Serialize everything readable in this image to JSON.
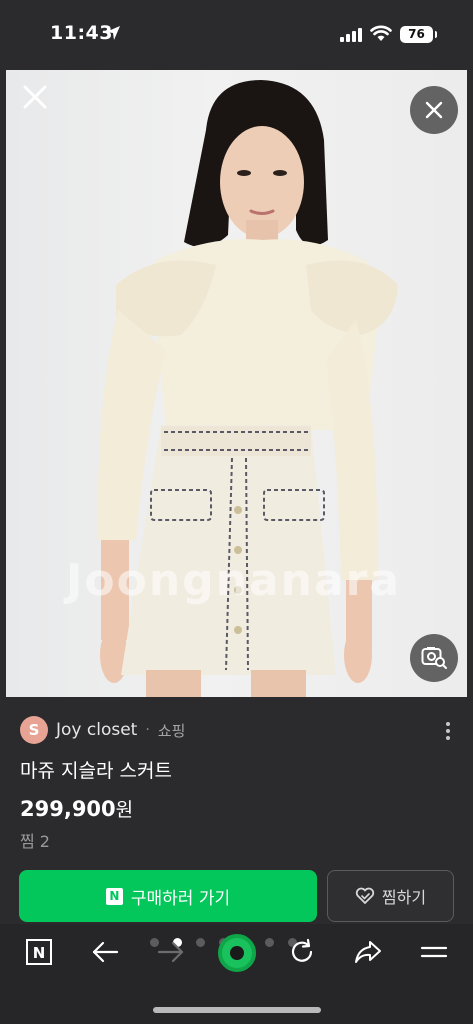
{
  "status_bar": {
    "time": "11:43",
    "battery": "76"
  },
  "photo": {
    "watermark": "Joongnanara"
  },
  "seller": {
    "avatar_letter": "S",
    "name": "Joy closet",
    "separator": "·",
    "type": "쇼핑"
  },
  "product": {
    "title": "마쥬 지슬라 스커트",
    "price": "299,900",
    "price_unit": "원",
    "likes": "찜 2"
  },
  "actions": {
    "buy_badge": "N",
    "buy_label": "구매하러 가기",
    "zzim_label": "찜하기"
  },
  "bottom_nav": {
    "home_badge": "N",
    "page_dots": 7,
    "active_dot": 1
  },
  "colors": {
    "accent_green": "#03c75a",
    "background": "#2b2b2d"
  }
}
